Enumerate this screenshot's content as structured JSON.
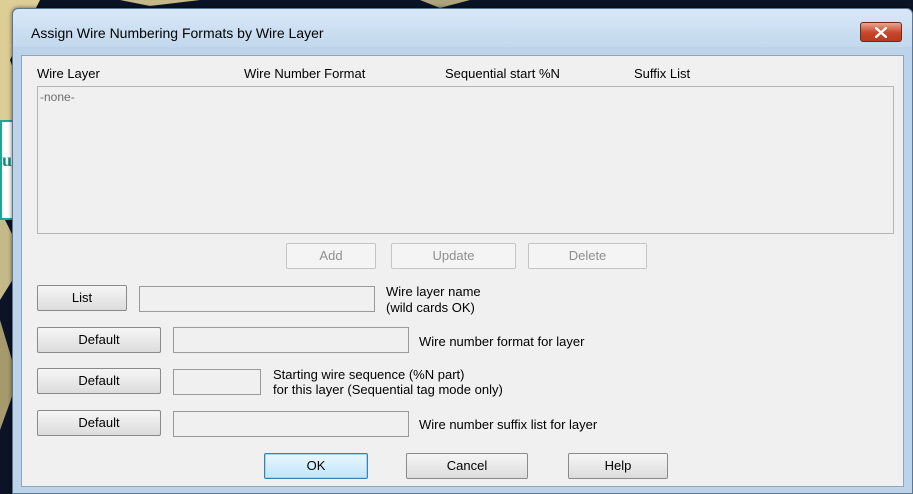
{
  "window": {
    "title": "Assign Wire Numbering Formats by Wire Layer"
  },
  "columns": [
    "Wire Layer",
    "Wire Number Format",
    "Sequential start %N",
    "Suffix List"
  ],
  "list": {
    "items": [
      "-none-"
    ]
  },
  "list_actions": {
    "add": "Add",
    "update": "Update",
    "delete": "Delete"
  },
  "rows": {
    "layer_name": {
      "button": "List",
      "value": "",
      "label_line1": "Wire layer name",
      "label_line2": "(wild cards OK)"
    },
    "number_format": {
      "button": "Default",
      "value": "",
      "label": "Wire number format for layer"
    },
    "start_sequence": {
      "button": "Default",
      "value": "",
      "label_line1": "Starting wire sequence (%N part)",
      "label_line2": "for this layer (Sequential tag mode only)"
    },
    "suffix_list": {
      "button": "Default",
      "value": "",
      "label": "Wire number suffix list for layer"
    }
  },
  "footer": {
    "ok": "OK",
    "cancel": "Cancel",
    "help": "Help"
  },
  "background_panel": {
    "text": "up"
  },
  "icons": {
    "close": "close-icon"
  },
  "colors": {
    "close_button": "#c7462a",
    "panel_border": "#1fa596"
  }
}
